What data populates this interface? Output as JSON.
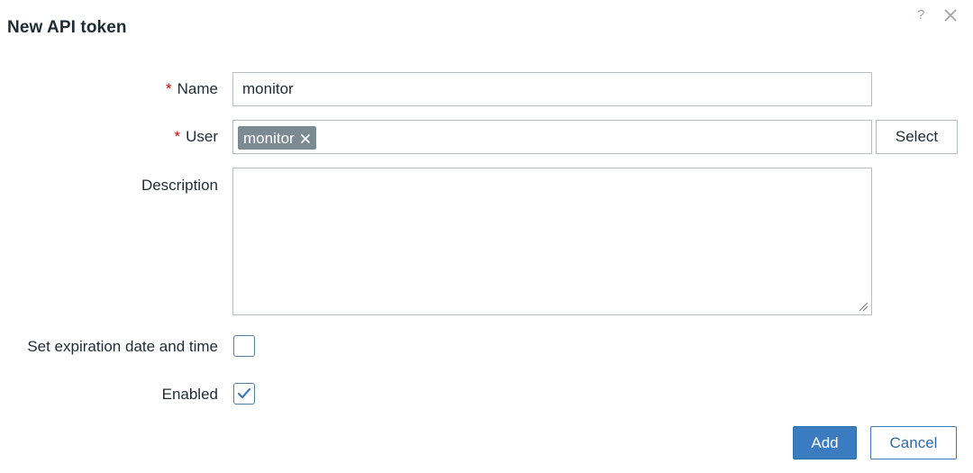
{
  "dialog": {
    "title": "New API token",
    "help_icon": "?",
    "close_icon": "close-icon"
  },
  "form": {
    "required_marker": "*",
    "name": {
      "label": "Name",
      "value": "monitor"
    },
    "user": {
      "label": "User",
      "chip_value": "monitor",
      "chip_remove_icon": "close-icon",
      "select_label": "Select"
    },
    "description": {
      "label": "Description",
      "value": ""
    },
    "expiration": {
      "label": "Set expiration date and time",
      "checked": false
    },
    "enabled": {
      "label": "Enabled",
      "checked": true
    }
  },
  "footer": {
    "add_label": "Add",
    "cancel_label": "Cancel"
  },
  "colors": {
    "primary": "#3b7cc0",
    "required": "#d40000",
    "chip_bg": "#7c8a92",
    "border": "#b7bdc0",
    "checkbox_border": "#4f7ea8"
  }
}
